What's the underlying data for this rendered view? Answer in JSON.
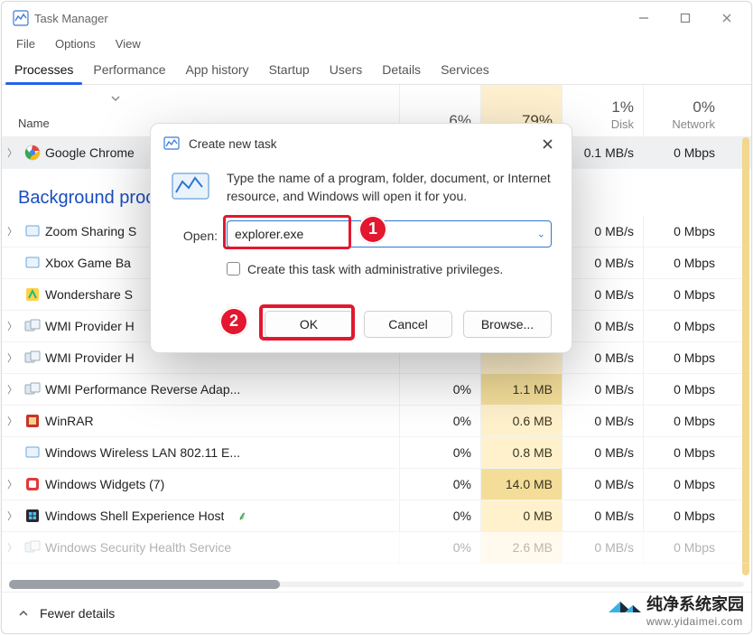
{
  "window": {
    "title": "Task Manager"
  },
  "menu": [
    "File",
    "Options",
    "View"
  ],
  "tabs": [
    "Processes",
    "Performance",
    "App history",
    "Startup",
    "Users",
    "Details",
    "Services"
  ],
  "activeTabIndex": 0,
  "columns": {
    "name": "Name",
    "metrics": [
      {
        "pct": "6%",
        "label": "",
        "key": "cpu",
        "mem": false
      },
      {
        "pct": "79%",
        "label": "",
        "key": "mem",
        "mem": true
      },
      {
        "pct": "1%",
        "label": "Disk",
        "key": "disk",
        "mem": false
      },
      {
        "pct": "0%",
        "label": "Network",
        "key": "net",
        "mem": false
      }
    ]
  },
  "section1": "",
  "rows_top": [
    {
      "name": "Google Chrome",
      "cpu": "",
      "mem": "",
      "disk": "0.1 MB/s",
      "net": "0 Mbps",
      "icon": "chrome",
      "exp": true,
      "sel": true
    }
  ],
  "section_bg": "Background proc",
  "rows_bg": [
    {
      "name": "Zoom Sharing S",
      "cpu": "",
      "mem": "",
      "disk": "0 MB/s",
      "net": "0 Mbps",
      "icon": "app",
      "exp": true
    },
    {
      "name": "Xbox Game Ba",
      "cpu": "",
      "mem": "",
      "disk": "0 MB/s",
      "net": "0 Mbps",
      "icon": "app",
      "exp": false
    },
    {
      "name": "Wondershare S",
      "cpu": "",
      "mem": "",
      "disk": "0 MB/s",
      "net": "0 Mbps",
      "icon": "wond",
      "exp": false
    },
    {
      "name": "WMI Provider H",
      "cpu": "",
      "mem": "",
      "disk": "0 MB/s",
      "net": "0 Mbps",
      "icon": "sys",
      "exp": true
    },
    {
      "name": "WMI Provider H",
      "cpu": "",
      "mem": "",
      "disk": "0 MB/s",
      "net": "0 Mbps",
      "icon": "sys",
      "exp": true
    },
    {
      "name": "WMI Performance Reverse Adap...",
      "cpu": "0%",
      "mem": "1.1 MB",
      "mem_dark": true,
      "disk": "0 MB/s",
      "net": "0 Mbps",
      "icon": "sys",
      "exp": true
    },
    {
      "name": "WinRAR",
      "cpu": "0%",
      "mem": "0.6 MB",
      "disk": "0 MB/s",
      "net": "0 Mbps",
      "icon": "rar",
      "exp": true
    },
    {
      "name": "Windows Wireless LAN 802.11 E...",
      "cpu": "0%",
      "mem": "0.8 MB",
      "disk": "0 MB/s",
      "net": "0 Mbps",
      "icon": "app",
      "exp": false
    },
    {
      "name": "Windows Widgets (7)",
      "cpu": "0%",
      "mem": "14.0 MB",
      "mem_dark": true,
      "disk": "0 MB/s",
      "net": "0 Mbps",
      "icon": "widg",
      "exp": true
    },
    {
      "name": "Windows Shell Experience Host",
      "cpu": "0%",
      "mem": "0 MB",
      "disk": "0 MB/s",
      "net": "0 Mbps",
      "icon": "shell",
      "exp": true,
      "leaf": true
    },
    {
      "name": "Windows Security Health Service",
      "cpu": "0%",
      "mem": "2.6 MB",
      "disk": "0 MB/s",
      "net": "0 Mbps",
      "icon": "sys",
      "exp": true,
      "faded": true
    }
  ],
  "footer": {
    "link": "Fewer details"
  },
  "dialog": {
    "title": "Create new task",
    "desc": "Type the name of a program, folder, document, or Internet resource, and Windows will open it for you.",
    "open_label": "Open:",
    "input_value": "explorer.exe",
    "admin_label": "Create this task with administrative privileges.",
    "ok": "OK",
    "cancel": "Cancel",
    "browse": "Browse..."
  },
  "callouts": {
    "one": "1",
    "two": "2"
  },
  "watermark": {
    "brand": "纯净系统家园",
    "site": "www.yidaimei.com"
  }
}
